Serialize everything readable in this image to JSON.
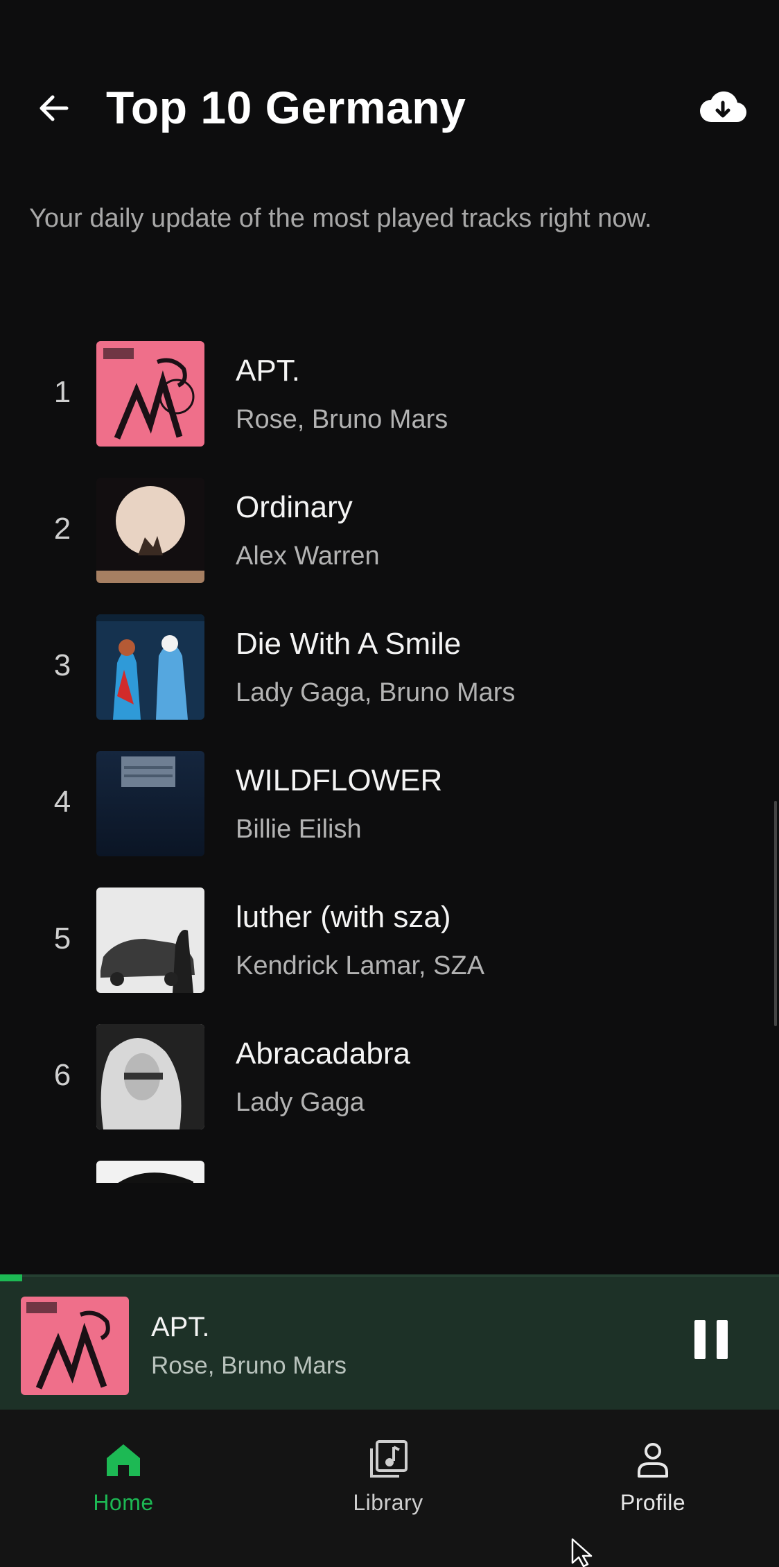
{
  "header": {
    "title": "Top 10 Germany",
    "subtitle": "Your daily update of the most played tracks right now."
  },
  "tracks": [
    {
      "rank": "1",
      "title": "APT.",
      "artist": "Rose, Bruno Mars"
    },
    {
      "rank": "2",
      "title": "Ordinary",
      "artist": "Alex Warren"
    },
    {
      "rank": "3",
      "title": "Die With A Smile",
      "artist": "Lady Gaga, Bruno Mars"
    },
    {
      "rank": "4",
      "title": "WILDFLOWER",
      "artist": "Billie Eilish"
    },
    {
      "rank": "5",
      "title": "luther (with sza)",
      "artist": "Kendrick Lamar, SZA"
    },
    {
      "rank": "6",
      "title": "Abracadabra",
      "artist": "Lady Gaga"
    }
  ],
  "now_playing": {
    "title": "APT.",
    "artist": "Rose, Bruno Mars",
    "progress_fraction": 0.03
  },
  "nav": {
    "home": "Home",
    "library": "Library",
    "profile": "Profile"
  },
  "icons": {
    "back": "arrow-left-icon",
    "download": "cloud-download-icon",
    "pause": "pause-icon",
    "home": "home-icon",
    "library": "library-icon",
    "profile": "profile-icon"
  },
  "colors": {
    "accent": "#1db954",
    "background": "#0d0d0e",
    "player_background": "#1d3127"
  }
}
